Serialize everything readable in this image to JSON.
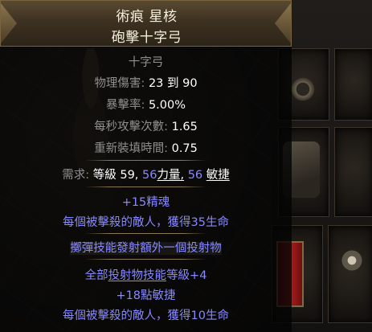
{
  "item": {
    "name": "術痕 星核",
    "base_type": "砲擊十字弓",
    "item_class": "十字弓",
    "properties": [
      {
        "label": "物理傷害:",
        "value": "23 到 90"
      },
      {
        "label": "暴擊率:",
        "value": "5.00%"
      },
      {
        "label": "每秒攻擊次數:",
        "value": "1.65"
      },
      {
        "label": "重新裝填時間:",
        "value": "0.75"
      }
    ],
    "requirements": {
      "prefix": "需求:",
      "level_label": "等級",
      "level_value": "59,",
      "str_value": "56",
      "str_label": "力量,",
      "dex_value": "56",
      "dex_label": "敏捷"
    },
    "implicit_mods": [
      "+15精魂",
      "每個被擊殺的敵人，獲得35生命"
    ],
    "rune_mod": "擲彈技能發射額外一個投射物",
    "explicit_mods": [
      {
        "prefix": "全部",
        "keyword": "投射物技能",
        "suffix": "等級+4"
      },
      {
        "text": "+18點敏捷"
      },
      {
        "text": "每個被擊殺的敵人，獲得10生命"
      }
    ]
  },
  "colors": {
    "header_text": "#f5f0dc",
    "label_grey": "#8f8f8f",
    "value_white": "#ffffff",
    "magic_blue": "#8888ff",
    "separator": "#8a7651"
  }
}
